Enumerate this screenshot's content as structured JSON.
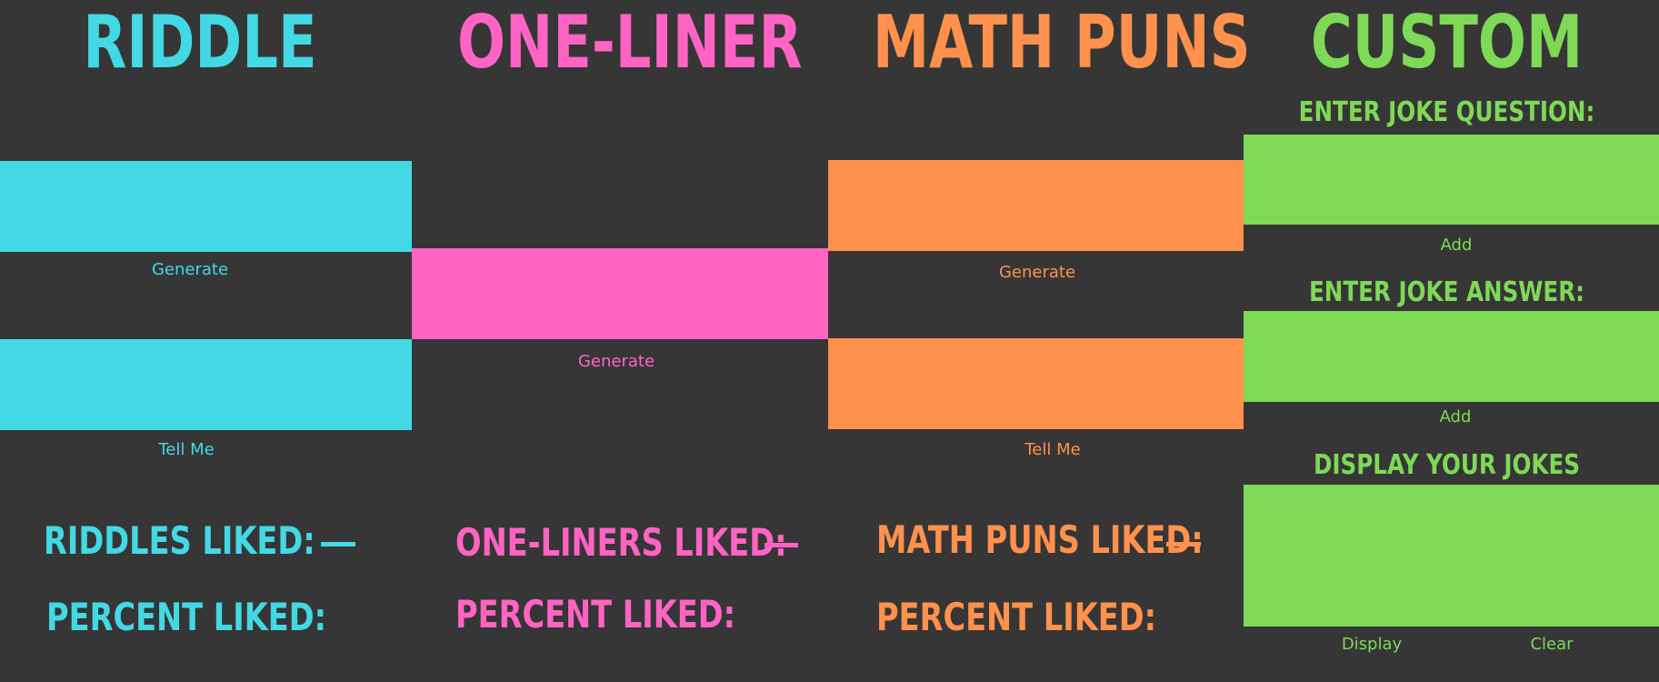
{
  "colors": {
    "background": "#363636",
    "riddle": "#42d9e5",
    "oneliner": "#ff64c4",
    "mathpuns": "#ff914d",
    "custom": "#7ed957"
  },
  "riddle": {
    "title": "RIDDLE",
    "generate_label": "Generate",
    "tell_me_label": "Tell Me",
    "liked_label": "RIDDLES LIKED:",
    "percent_label": "PERCENT LIKED:"
  },
  "oneliner": {
    "title": "ONE-LINER",
    "generate_label": "Generate",
    "liked_label": "ONE-LINERS LIKED:",
    "percent_label": "PERCENT LIKED:"
  },
  "mathpuns": {
    "title": "MATH PUNS",
    "generate_label": "Generate",
    "tell_me_label": "Tell Me",
    "liked_label": "MATH PUNS LIKED:",
    "percent_label": "PERCENT LIKED:"
  },
  "custom": {
    "title": "CUSTOM",
    "question_label": "ENTER JOKE QUESTION:",
    "add_question_label": "Add",
    "answer_label": "ENTER JOKE ANSWER:",
    "add_answer_label": "Add",
    "display_label": "DISPLAY YOUR JOKES",
    "display_button_label": "Display",
    "clear_button_label": "Clear"
  }
}
